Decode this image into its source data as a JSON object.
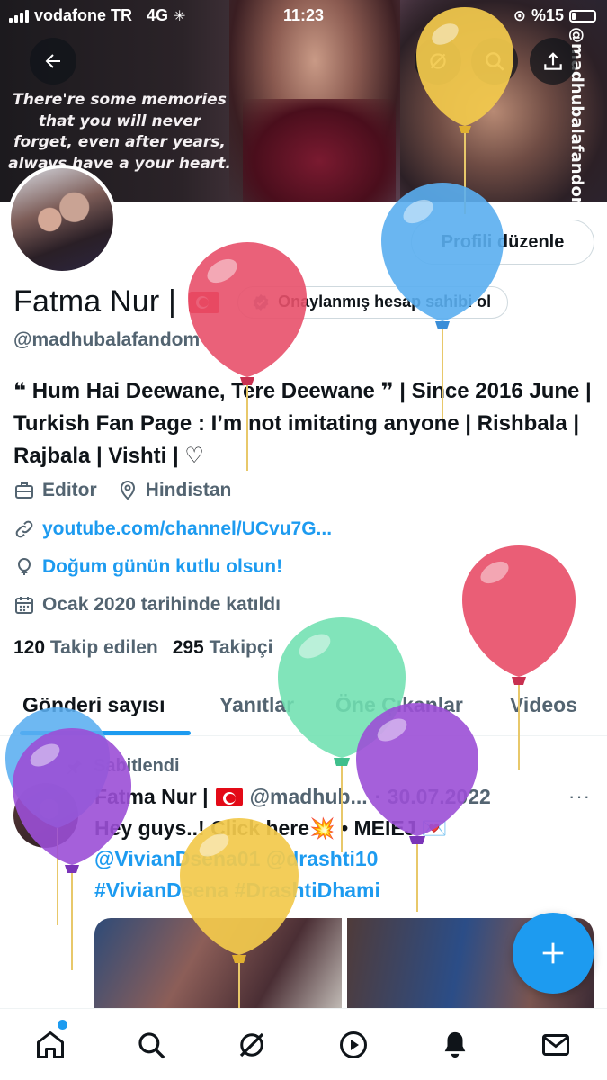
{
  "status_bar": {
    "carrier": "vodafone TR",
    "network": "4G",
    "time": "11:23",
    "battery": "%15"
  },
  "banner": {
    "quote": "There're some memories that you will never forget, even after years, always have a your heart.",
    "watermark": "@madhubalafandom"
  },
  "profile": {
    "edit_button": "Profili düzenle",
    "display_name": "Fatma Nur |",
    "verify_button": "Onaylanmış hesap sahibi ol",
    "handle": "@madhubalafandom",
    "bio": "❝ Hum Hai Deewane, Tere Deewane ❞ | Since 2016 June | Turkish Fan Page : I’m not imitating anyone | Rishbala | Rajbala | Vishti | ♡",
    "job": "Editor",
    "location": "Hindistan",
    "website": "youtube.com/channel/UCvu7G...",
    "birthday": "Doğum günün kutlu olsun!",
    "joined": "Ocak 2020 tarihinde katıldı",
    "following_count": "120",
    "following_label": "Takip edilen",
    "followers_count": "295",
    "followers_label": "Takipçi"
  },
  "tabs": [
    "Gönderi sayısı",
    "Yanıtlar",
    "Öne Çıkanlar",
    "Videos"
  ],
  "post": {
    "pinned_label": "Sabitlendi",
    "author": "Fatma Nur |",
    "handle": "@madhub...",
    "date": "· 30.07.2022",
    "line1": "Hey guys..! Click here💥 • MEIEJ 💌",
    "line2": "@VivianDsena01 @drashti10",
    "line3": "#VivianDsena #DrashtiDhami",
    "more": "···"
  },
  "colors": {
    "accent": "#1d9bf0",
    "text": "#0f1419",
    "secondary": "#536471",
    "balloon_yellow": "#f2c94c",
    "balloon_blue": "#5aaef0",
    "balloon_red": "#e8506a",
    "balloon_green": "#6fe0b0",
    "balloon_purple": "#9b4fd6"
  },
  "bottom_nav": [
    "home-icon",
    "search-icon",
    "grok-icon",
    "video-icon",
    "bell-icon",
    "mail-icon"
  ]
}
